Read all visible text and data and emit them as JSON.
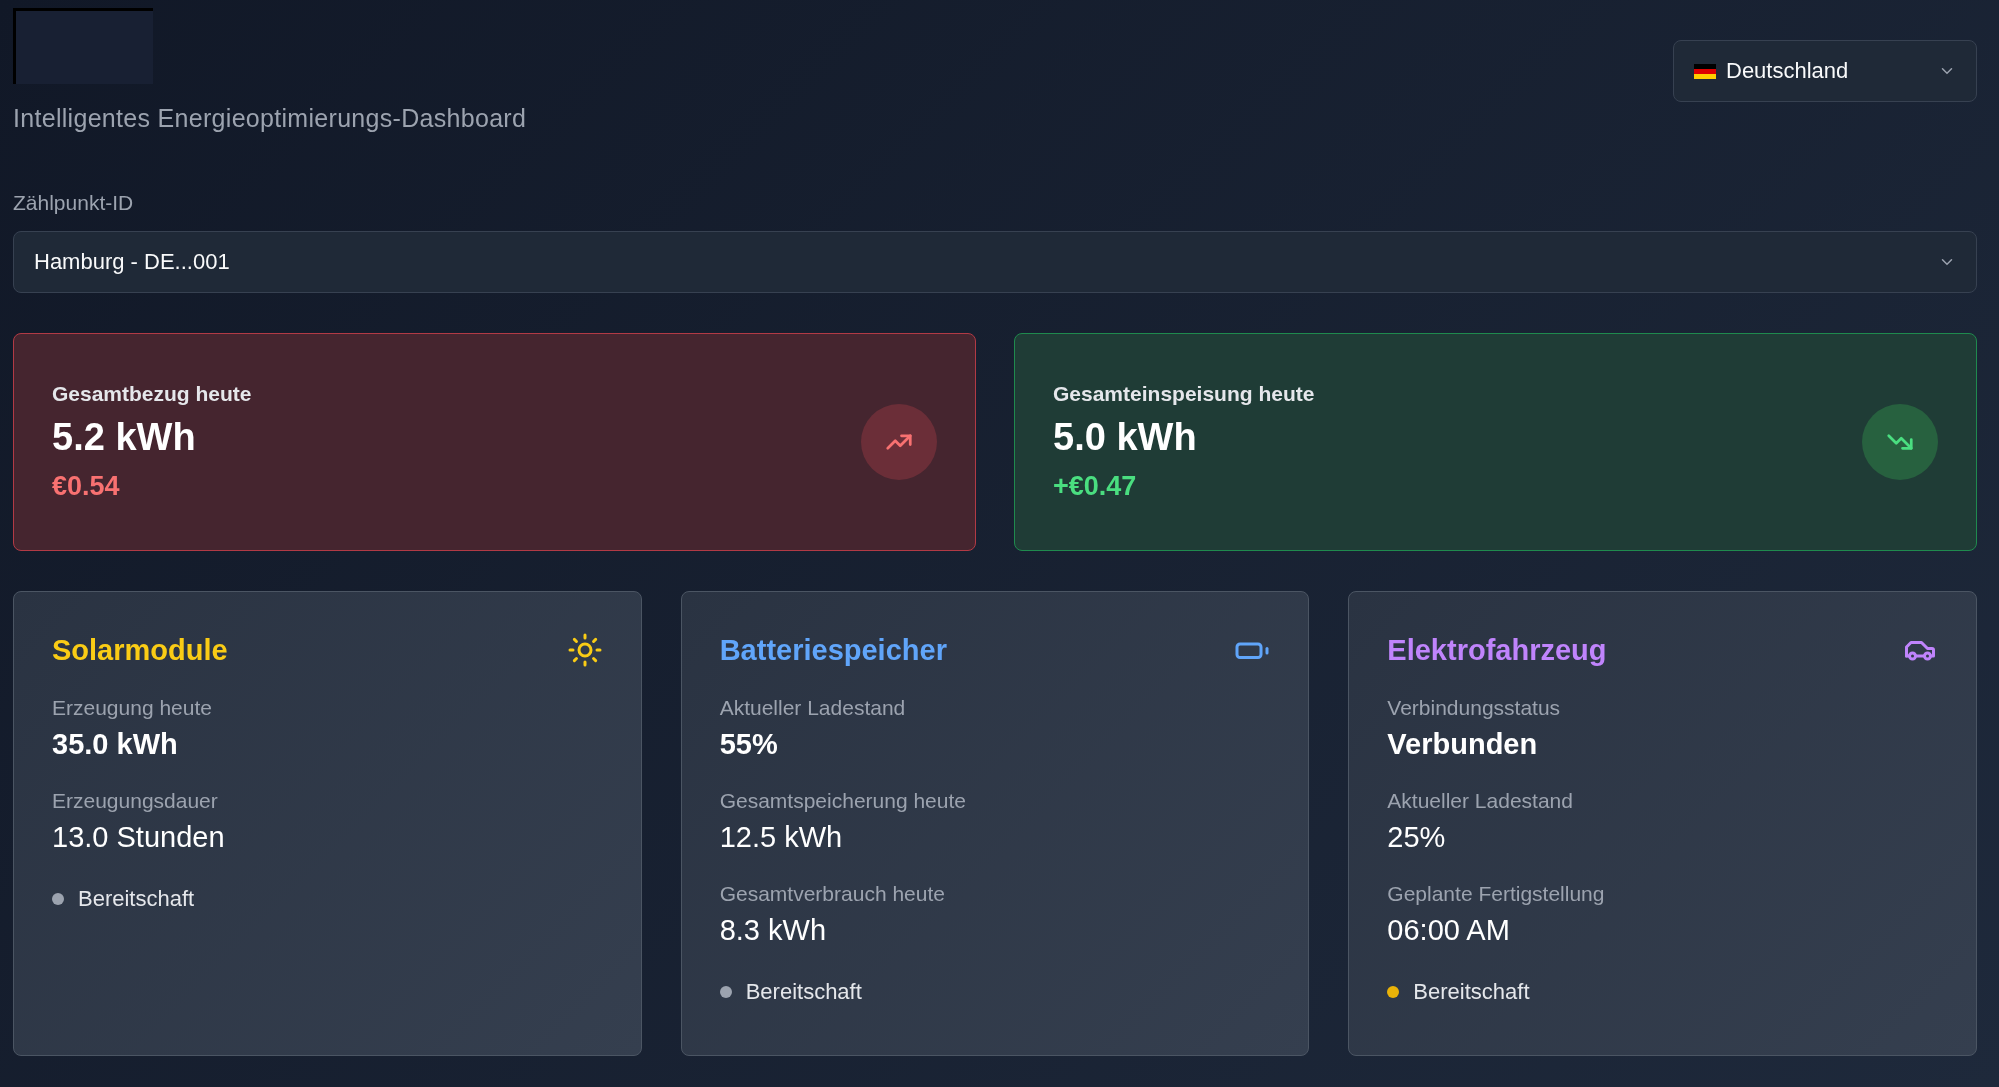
{
  "header": {
    "subtitle": "Intelligentes Energieoptimierungs-Dashboard",
    "country_select": {
      "value": "Deutschland"
    }
  },
  "meter": {
    "label": "Zählpunkt-ID",
    "select": {
      "value": "Hamburg - DE...001"
    }
  },
  "summary": [
    {
      "kind": "import",
      "title": "Gesamtbezug heute",
      "value": "5.2 kWh",
      "amount": "€0.54"
    },
    {
      "kind": "export",
      "title": "Gesamteinspeisung heute",
      "value": "5.0 kWh",
      "amount": "+€0.47"
    }
  ],
  "devices": [
    {
      "kind": "solar",
      "title": "Solarmodule",
      "metrics": [
        {
          "label": "Erzeugung heute",
          "value": "35.0 kWh",
          "bold": true
        },
        {
          "label": "Erzeugungsdauer",
          "value": "13.0 Stunden",
          "bold": false
        }
      ],
      "status": {
        "text": "Bereitschaft",
        "color": "#9ca3af"
      }
    },
    {
      "kind": "battery",
      "title": "Batteriespeicher",
      "metrics": [
        {
          "label": "Aktueller Ladestand",
          "value": "55%",
          "bold": true
        },
        {
          "label": "Gesamtspeicherung heute",
          "value": "12.5 kWh",
          "bold": false
        },
        {
          "label": "Gesamtverbrauch heute",
          "value": "8.3 kWh",
          "bold": false
        }
      ],
      "status": {
        "text": "Bereitschaft",
        "color": "#9ca3af"
      }
    },
    {
      "kind": "ev",
      "title": "Elektrofahrzeug",
      "metrics": [
        {
          "label": "Verbindungsstatus",
          "value": "Verbunden",
          "bold": true
        },
        {
          "label": "Aktueller Ladestand",
          "value": "25%",
          "bold": false
        },
        {
          "label": "Geplante Fertigstellung",
          "value": "06:00 AM",
          "bold": false
        }
      ],
      "status": {
        "text": "Bereitschaft",
        "color": "#eab308"
      }
    }
  ]
}
